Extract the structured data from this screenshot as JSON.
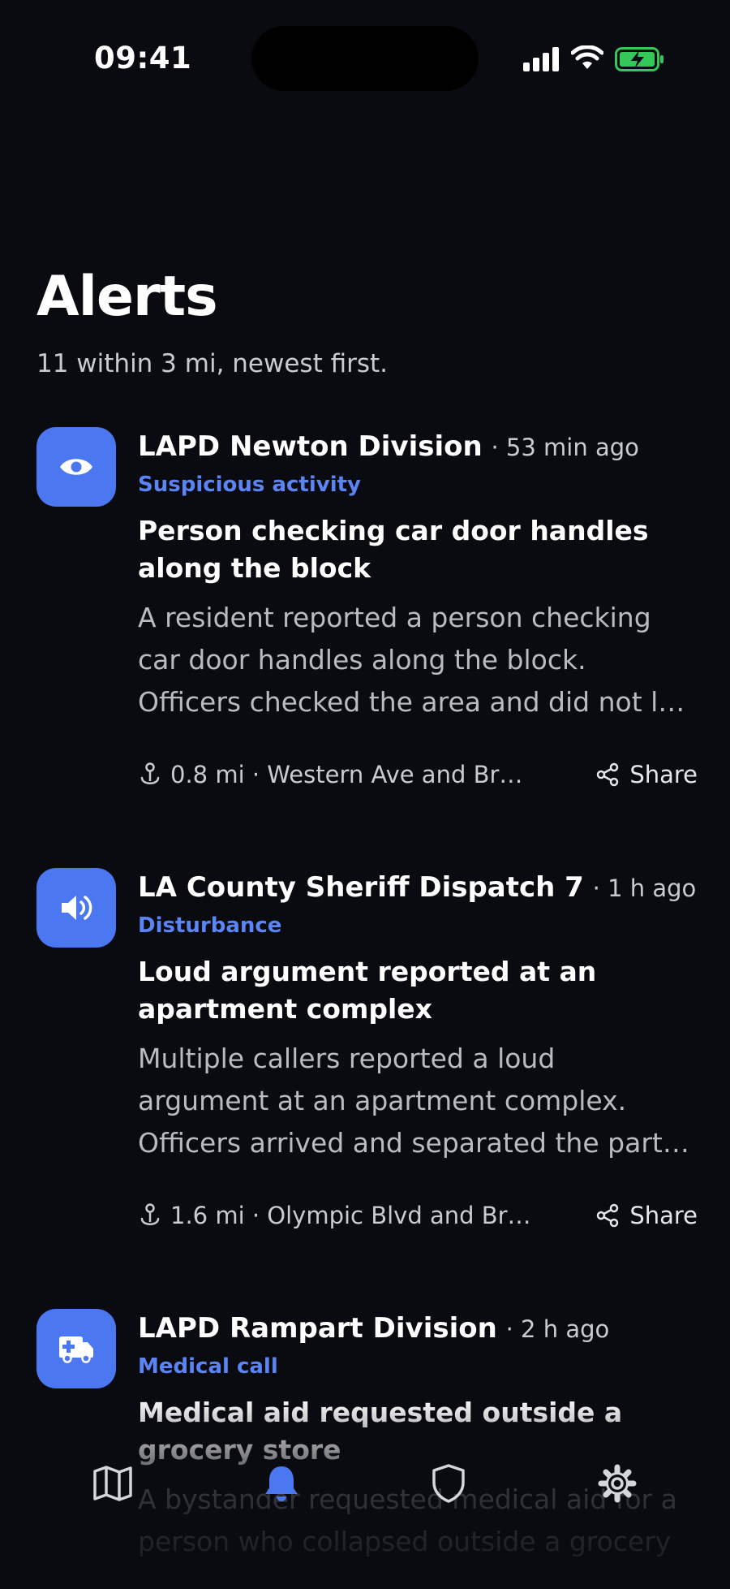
{
  "status_bar": {
    "time": "09:41",
    "battery_color": "#34c759"
  },
  "header": {
    "title": "Alerts",
    "subtitle": "11 within 3 mi, newest first."
  },
  "accent_color": "#4b78f0",
  "alerts": [
    {
      "icon": "eye-icon",
      "source": "LAPD Newton Division",
      "time_ago": "· 53 min ago",
      "category": "Suspicious activity",
      "headline": "Person checking car door handles along the block",
      "description": "A resident reported a person checking car door handles along the block. Officers checked the area and did not l…",
      "location": "0.8 mi · Western Ave and Br…",
      "share_label": "Share"
    },
    {
      "icon": "speaker-icon",
      "source": "LA County Sheriff Dispatch 7",
      "time_ago": "· 1 h ago",
      "category": "Disturbance",
      "headline": "Loud argument reported at an apartment complex",
      "description": "Multiple callers reported a loud argument at an apartment complex. Officers arrived and separated the part…",
      "location": "1.6 mi · Olympic Blvd and Br…",
      "share_label": "Share"
    },
    {
      "icon": "ambulance-icon",
      "source": "LAPD Rampart Division",
      "time_ago": "· 2 h ago",
      "category": "Medical call",
      "headline": "Medical aid requested outside a grocery store",
      "description": "A bystander requested medical aid for a person who collapsed outside a grocery"
    }
  ],
  "tabs": [
    {
      "icon": "map-icon",
      "active": false
    },
    {
      "icon": "bell-icon",
      "active": true
    },
    {
      "icon": "shield-icon",
      "active": false
    },
    {
      "icon": "gear-icon",
      "active": false
    }
  ]
}
